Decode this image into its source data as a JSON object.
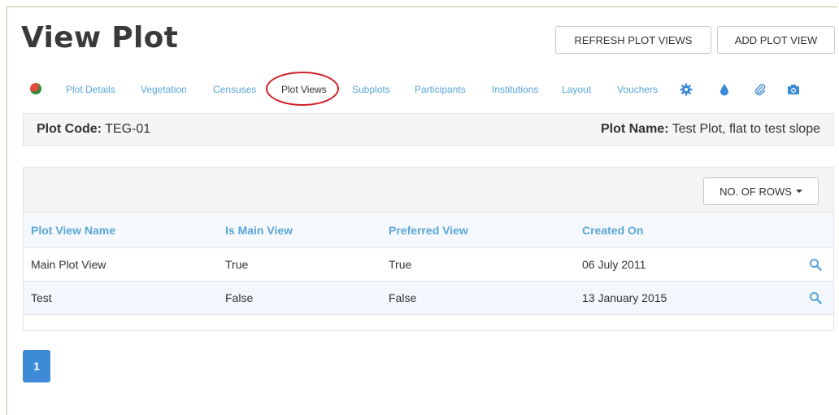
{
  "page": {
    "title": "View Plot"
  },
  "header_buttons": {
    "refresh": "REFRESH PLOT VIEWS",
    "add": "ADD PLOT VIEW"
  },
  "tabs": [
    {
      "label": "Plot Details"
    },
    {
      "label": "Vegetation"
    },
    {
      "label": "Censuses"
    },
    {
      "label": "Plot Views",
      "active": true
    },
    {
      "label": "Subplots"
    },
    {
      "label": "Participants"
    },
    {
      "label": "Institutions"
    },
    {
      "label": "Layout"
    },
    {
      "label": "Vouchers"
    }
  ],
  "tab_icons": [
    "globe-icon",
    "gear-icon",
    "water-drop-icon",
    "paperclip-icon",
    "camera-icon"
  ],
  "info": {
    "code_label": "Plot Code:",
    "code_value": "TEG-01",
    "name_label": "Plot Name:",
    "name_value": "Test Plot, flat to test slope"
  },
  "table": {
    "rows_button": "NO. OF ROWS",
    "headers": [
      "Plot View Name",
      "Is Main View",
      "Preferred View",
      "Created On"
    ],
    "rows": [
      [
        "Main Plot View",
        "True",
        "True",
        "06 July 2011"
      ],
      [
        "Test",
        "False",
        "False",
        "13 January 2015"
      ]
    ]
  },
  "pagination": {
    "current": "1"
  },
  "colors": {
    "accent": "#5aa6d6",
    "primary": "#3d8bd6",
    "highlight": "#d21f26"
  }
}
